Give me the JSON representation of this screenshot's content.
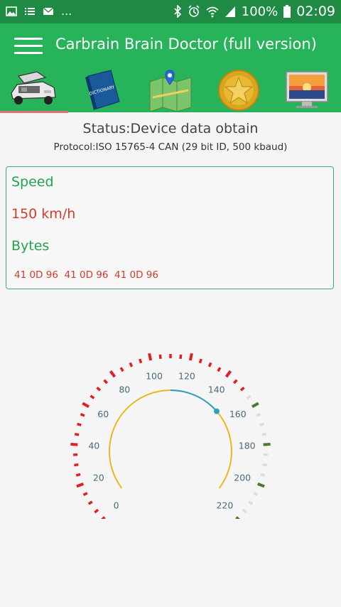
{
  "status_bar": {
    "left_icons": [
      "gallery-icon",
      "list-icon",
      "email-icon",
      "more-notifications"
    ],
    "more_text": "...",
    "right_icons": [
      "bluetooth-icon",
      "alarm-icon",
      "wifi-icon",
      "signal-icon",
      "battery-icon"
    ],
    "battery": "100%",
    "time": "02:09"
  },
  "app_bar": {
    "title": "Carbrain Brain Doctor (full version)"
  },
  "tabs": [
    {
      "name": "car-engine",
      "icon": "car-hood-open-icon",
      "selected": true
    },
    {
      "name": "dictionary",
      "icon": "dictionary-book-icon",
      "label": "DICTIONARY"
    },
    {
      "name": "map",
      "icon": "map-pin-icon"
    },
    {
      "name": "award",
      "icon": "gold-star-coin-icon"
    },
    {
      "name": "display",
      "icon": "monitor-sunset-icon"
    }
  ],
  "status": {
    "status_text": "Status:Device data obtain",
    "protocol_text": "Protocol:ISO 15765-4 CAN (29 bit ID, 500 kbaud)"
  },
  "data_box": {
    "speed_label": "Speed",
    "speed_value": "150 km/h",
    "bytes_label": "Bytes",
    "bytes_value": "41 0D 96  41 0D 96  41 0D 96"
  },
  "gauge": {
    "min": 0,
    "max": 220,
    "value": 150,
    "tick_labels": [
      "0",
      "20",
      "40",
      "60",
      "80",
      "100",
      "120",
      "140",
      "160",
      "180",
      "200",
      "220"
    ],
    "colors": {
      "red_zone": "#e02020",
      "gray_zone": "#dcdcdc",
      "green_mark": "#4a7a2a",
      "yellow_arc": "#e8b820",
      "blue_progress": "#2aa0c8",
      "label": "#4a6a7a"
    }
  },
  "colors": {
    "status_bar": "#1e8a44",
    "app_bar": "#26b35a",
    "green_text": "#25a24f",
    "red_text": "#d23c2c"
  }
}
